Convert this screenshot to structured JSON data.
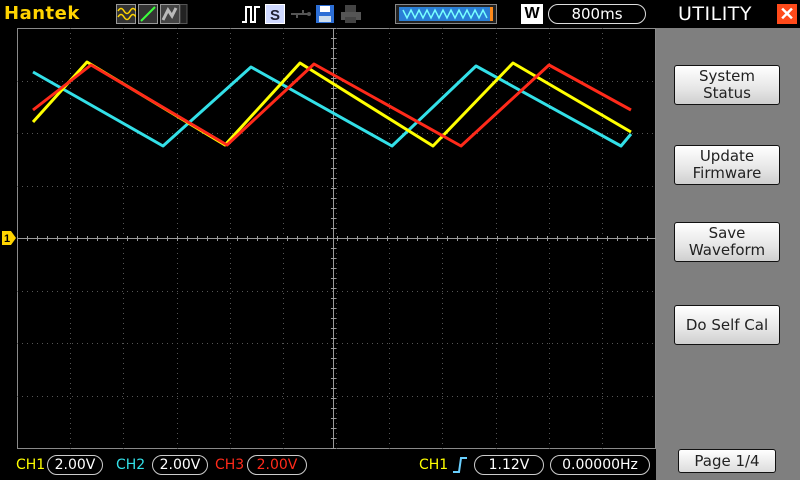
{
  "header": {
    "brand": "Hantek",
    "timebase_mode": "W",
    "timebase": "800ms"
  },
  "panel": {
    "title": "UTILITY",
    "buttons": [
      {
        "line1": "System",
        "line2": "Status"
      },
      {
        "line1": "Update",
        "line2": "Firmware"
      },
      {
        "line1": "Save",
        "line2": "Waveform"
      },
      {
        "line1": "Do Self Cal",
        "line2": ""
      }
    ],
    "page": "Page 1/4"
  },
  "footer": {
    "ch1": {
      "label": "CH1",
      "value": "2.00V",
      "color": "#ffff00"
    },
    "ch2": {
      "label": "CH2",
      "value": "2.00V",
      "color": "#33e0e8"
    },
    "ch3": {
      "label": "CH3",
      "value": "2.00V",
      "color": "#ff2a1a"
    },
    "trigger": {
      "label": "CH1",
      "level": "1.12V",
      "freq": "0.00000Hz"
    }
  },
  "marker": {
    "label": "1",
    "color": "#ffd400"
  },
  "colors": {
    "ch1": "#ffff00",
    "ch2": "#33e0e8",
    "ch3": "#ff2a1a",
    "accent": "#ffd400"
  },
  "icons": [
    "wave-mode-icon",
    "dot-mode-icon",
    "persist-icon",
    "trigger-pulse-icon",
    "stop-s-icon",
    "usb-icon",
    "save-disk-icon",
    "print-icon",
    "memory-bar-icon"
  ]
}
